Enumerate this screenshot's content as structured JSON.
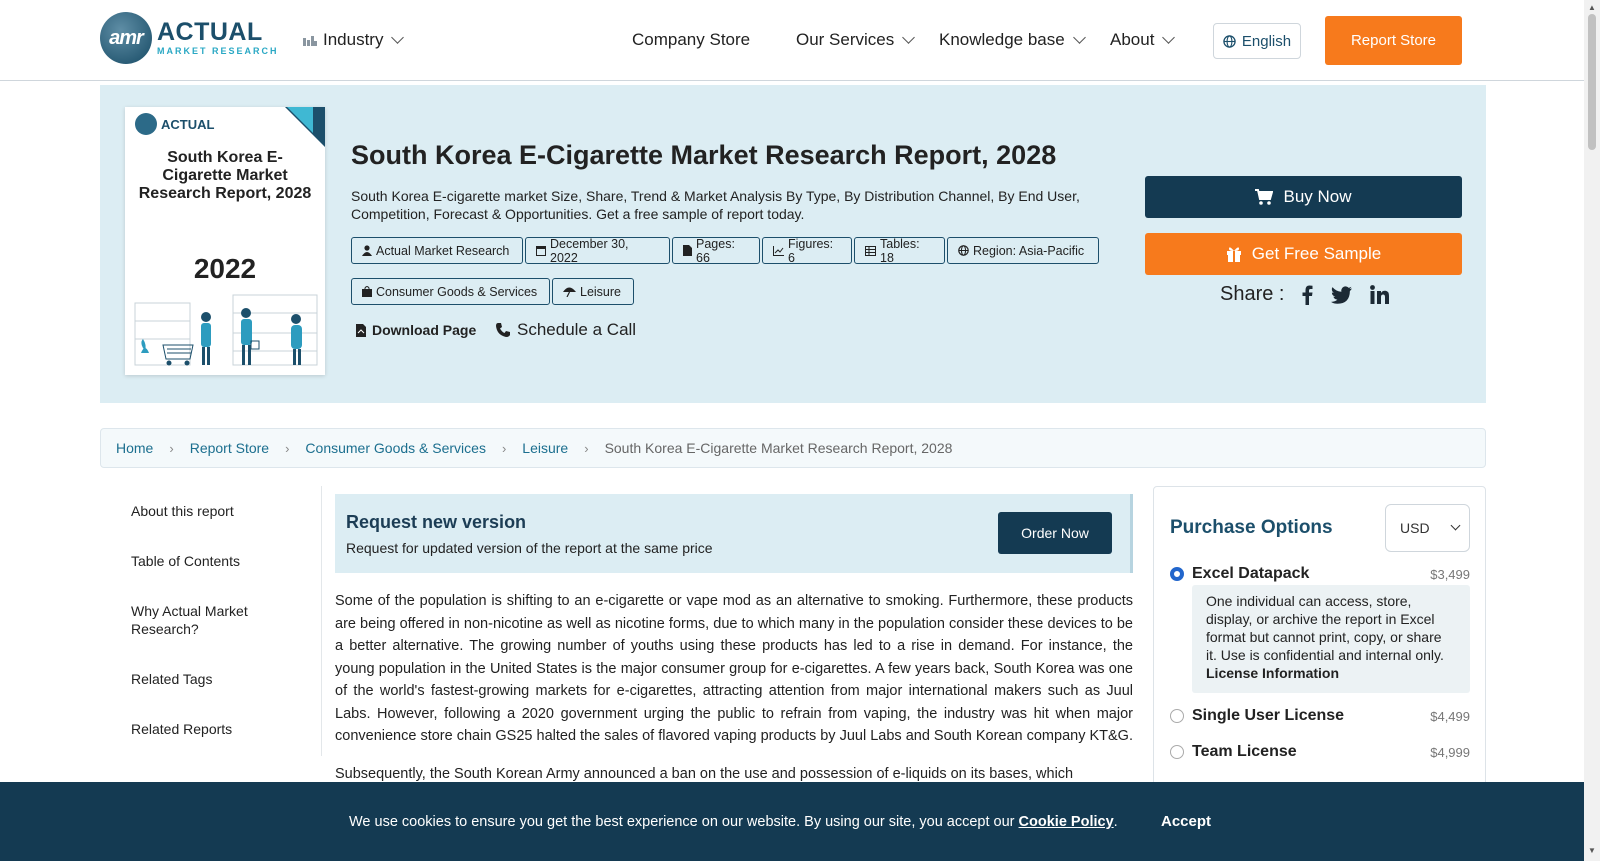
{
  "header": {
    "logo": {
      "mark": "amr",
      "name": "ACTUAL",
      "tagline": "MARKET RESEARCH"
    },
    "industry_label": "Industry",
    "nav": [
      "Company Store",
      "Our Services",
      "Knowledge base",
      "About"
    ],
    "language": "English",
    "report_store_button": "Report Store"
  },
  "hero": {
    "cover": {
      "brand": "ACTUAL",
      "title": "South Korea E-Cigarette Market Research Report, 2028",
      "year": "2022"
    },
    "title": "South Korea E-Cigarette Market Research Report, 2028",
    "subtitle": "South Korea E-cigarette market Size, Share, Trend & Market Analysis By Type, By Distribution Channel, By End User, Competition, Forecast & Opportunities. Get a free sample of report today.",
    "tags": [
      {
        "icon": "user-icon",
        "label": "Actual Market Research"
      },
      {
        "icon": "calendar-icon",
        "label": "December 30, 2022"
      },
      {
        "icon": "file-icon",
        "label": "Pages: 66"
      },
      {
        "icon": "chart-icon",
        "label": "Figures: 6"
      },
      {
        "icon": "table-icon",
        "label": "Tables: 18"
      },
      {
        "icon": "globe-icon",
        "label": "Region: Asia-Pacific"
      }
    ],
    "categories": [
      {
        "icon": "bag-icon",
        "label": "Consumer Goods & Services"
      },
      {
        "icon": "umbrella-icon",
        "label": "Leisure"
      }
    ],
    "download": "Download Page",
    "schedule": "Schedule a Call",
    "buy_now": "Buy Now",
    "free_sample": "Get Free Sample",
    "share_label": "Share :"
  },
  "breadcrumb": [
    "Home",
    "Report Store",
    "Consumer Goods & Services",
    "Leisure",
    "South Korea E-Cigarette Market Research Report, 2028"
  ],
  "sidebar": [
    "About this report",
    "Table of Contents",
    "Why Actual Market Research?",
    "Related Tags",
    "Related Reports"
  ],
  "request": {
    "title": "Request new version",
    "subtitle": "Request for updated version of the report at the same price",
    "button": "Order Now"
  },
  "body": [
    "Some of the population is shifting to an e-cigarette or vape mod as an alternative to smoking. Furthermore, these products are being offered in non-nicotine as well as nicotine forms, due to which many in the population consider these devices to be a better alternative. The growing number of youths using these products has led to a rise in demand. For instance, the young population in the United States is the major consumer group for e-cigarettes. A few years back, South Korea was one of the world's fastest-growing markets for e-cigarettes, attracting attention from major international makers such as Juul Labs. However, following a 2020 government urging the public to refrain from vaping, the industry was hit when major convenience store chain GS25 halted the sales of flavored vaping products by Juul Labs and South Korean company KT&G.",
    "Subsequently, the South Korean Army announced a ban on the use and possession of e-liquids on its bases, which"
  ],
  "purchase": {
    "title": "Purchase Options",
    "currency": "USD",
    "options": [
      {
        "name": "Excel Datapack",
        "price": "$3,499",
        "selected": true
      },
      {
        "name": "Single User License",
        "price": "$4,499",
        "selected": false
      },
      {
        "name": "Team License",
        "price": "$4,999",
        "selected": false
      }
    ],
    "desc": "One individual can access, store, display, or archive the report in Excel format but cannot print, copy, or share it. Use is confidential and internal only.",
    "desc_link": "License Information"
  },
  "cookie": {
    "text": "We use cookies to ensure you get the best experience on our website. By using our site, you accept our",
    "link": "Cookie Policy",
    "end": ".",
    "accept": "Accept"
  }
}
